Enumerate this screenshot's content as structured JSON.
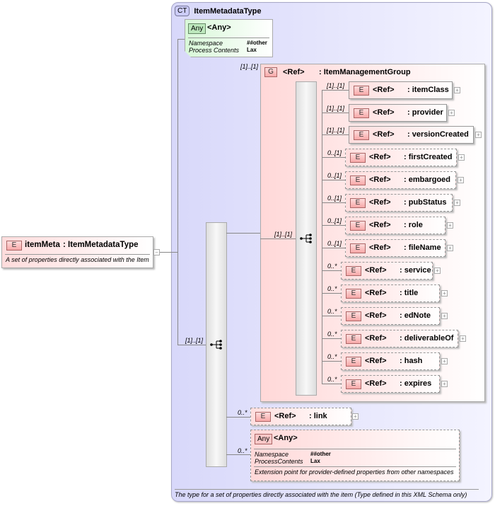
{
  "complex_type": {
    "badge": "CT",
    "name": "ItemMetadataType",
    "documentation": "The type for a set of properties directly associated with the item (Type defined in this XML Schema only)"
  },
  "root_element": {
    "badge": "E",
    "name": "itemMeta",
    "type": ": ItemMetadataType",
    "documentation": "A set of properties directly associated with the Item"
  },
  "any_top": {
    "badge": "Any",
    "title": "<Any>",
    "namespace_label": "Namespace",
    "namespace_value": "##other",
    "process_label": "Process Contents",
    "process_value": "Lax"
  },
  "outer_sequence": {
    "cardinality": "[1]..[1]"
  },
  "group": {
    "badge": "G",
    "ref": "<Ref>",
    "name": ": ItemManagementGroup",
    "cardinality": "[1]..[1]",
    "sequence_cardinality": "[1]..[1]"
  },
  "group_elements": [
    {
      "card": "[1]..[1]",
      "ref": "<Ref>",
      "name": ": itemClass",
      "optional": false
    },
    {
      "card": "[1]..[1]",
      "ref": "<Ref>",
      "name": ": provider",
      "optional": false
    },
    {
      "card": "[1]..[1]",
      "ref": "<Ref>",
      "name": ": versionCreated",
      "optional": false
    },
    {
      "card": "0..[1]",
      "ref": "<Ref>",
      "name": ": firstCreated",
      "optional": true
    },
    {
      "card": "0..[1]",
      "ref": "<Ref>",
      "name": ": embargoed",
      "optional": true
    },
    {
      "card": "0..[1]",
      "ref": "<Ref>",
      "name": ": pubStatus",
      "optional": true
    },
    {
      "card": "0..[1]",
      "ref": "<Ref>",
      "name": ": role",
      "optional": true
    },
    {
      "card": "0..[1]",
      "ref": "<Ref>",
      "name": ": fileName",
      "optional": true
    },
    {
      "card": "0..*",
      "ref": "<Ref>",
      "name": ": service",
      "optional": true
    },
    {
      "card": "0..*",
      "ref": "<Ref>",
      "name": ": title",
      "optional": true
    },
    {
      "card": "0..*",
      "ref": "<Ref>",
      "name": ": edNote",
      "optional": true
    },
    {
      "card": "0..*",
      "ref": "<Ref>",
      "name": ": deliverableOf",
      "optional": true
    },
    {
      "card": "0..*",
      "ref": "<Ref>",
      "name": ": hash",
      "optional": true
    },
    {
      "card": "0..*",
      "ref": "<Ref>",
      "name": ": expires",
      "optional": true
    }
  ],
  "link": {
    "card": "0..*",
    "badge": "E",
    "ref": "<Ref>",
    "name": ": link"
  },
  "any_bottom": {
    "card": "0..*",
    "badge": "Any",
    "title": "<Any>",
    "namespace_label": "Namespace",
    "namespace_value": "##other",
    "process_label": "ProcessContents",
    "process_value": "Lax",
    "documentation": "Extension point for provider-defined properties from other namespaces"
  }
}
